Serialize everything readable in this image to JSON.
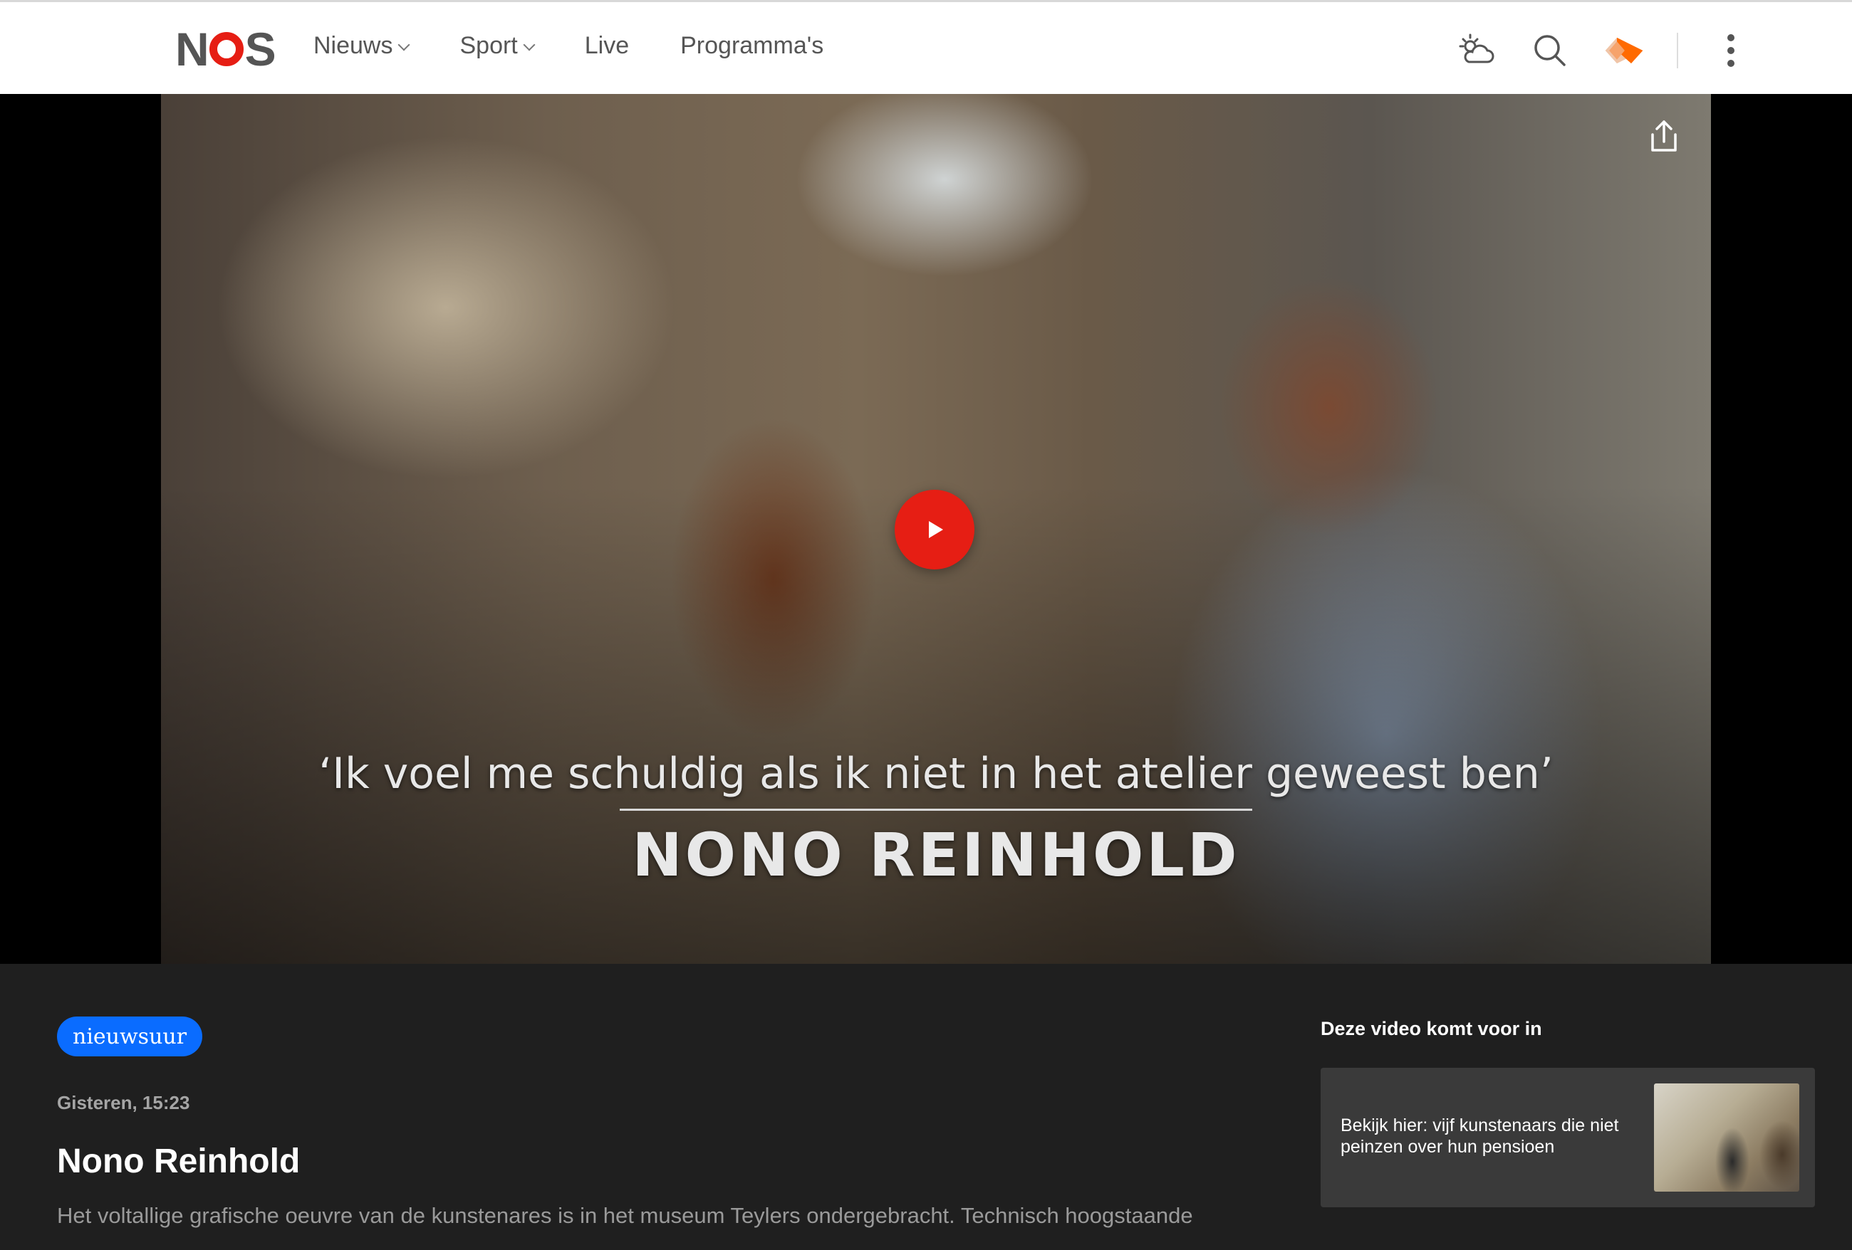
{
  "header": {
    "logo": "NOS",
    "nav": [
      {
        "label": "Nieuws",
        "has_dropdown": true
      },
      {
        "label": "Sport",
        "has_dropdown": true
      },
      {
        "label": "Live",
        "has_dropdown": false
      },
      {
        "label": "Programma's",
        "has_dropdown": false
      }
    ],
    "icons": [
      "weather-icon",
      "search-icon",
      "npo-start-icon",
      "more-menu-icon"
    ]
  },
  "video": {
    "subtitle": "‘Ik voel me schuldig als ik niet in het atelier geweest ben’",
    "nameplate": "NONO REINHOLD"
  },
  "article": {
    "badge": "nieuwsuur",
    "date": "Gisteren, 15:23",
    "title": "Nono Reinhold",
    "description": "Het voltallige grafische oeuvre van de kunstenares is in het museum Teylers ondergebracht. Technisch hoogstaande"
  },
  "related": {
    "heading": "Deze video komt voor in",
    "card_text": "Bekijk hier: vijf kunstenaars die niet peinzen over hun pensioen"
  },
  "colors": {
    "accent_red": "#e61e14",
    "badge_blue": "#0a6cff",
    "background": "#1f1f1f"
  }
}
